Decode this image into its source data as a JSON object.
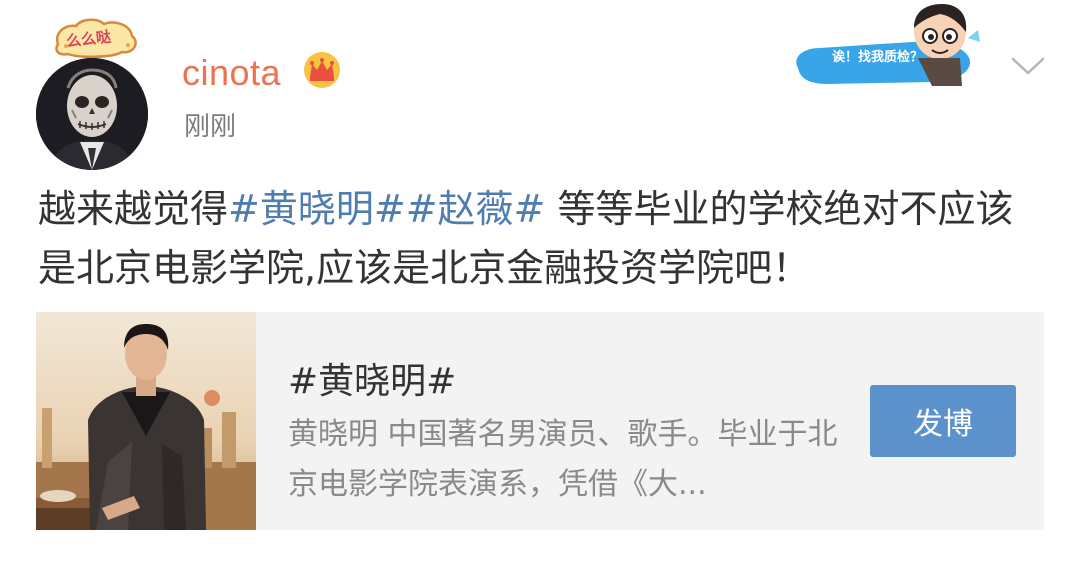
{
  "post": {
    "user": {
      "name": "cinota",
      "badge_text": "么么哒",
      "crown_icon": "crown-icon",
      "avatar_icon": "skull-face-avatar"
    },
    "timestamp": "刚刚",
    "sticker": {
      "text": "诶！找我质检？",
      "icon": "cartoon-boy-sticker"
    },
    "menu_icon": "chevron-down-icon",
    "body": {
      "text_before": "越来越觉得",
      "topic_1": "#黄晓明#",
      "topic_2": "#赵薇#",
      "text_after": " 等等毕业的学校绝对不应该是北京电影学院,应该是北京金融投资学院吧！"
    },
    "topic_card": {
      "title": "#黄晓明#",
      "description": "黄晓明 中国著名男演员、歌手。毕业于北京电影学院表演系，凭借《大...",
      "button_label": "发博",
      "thumbnail_icon": "man-in-suit-photo"
    }
  },
  "colors": {
    "username": "#eb7350",
    "topic_link": "#507daf",
    "button_bg": "#5b92cb",
    "card_bg": "#f3f3f3",
    "timestamp": "#7b7b7b"
  }
}
